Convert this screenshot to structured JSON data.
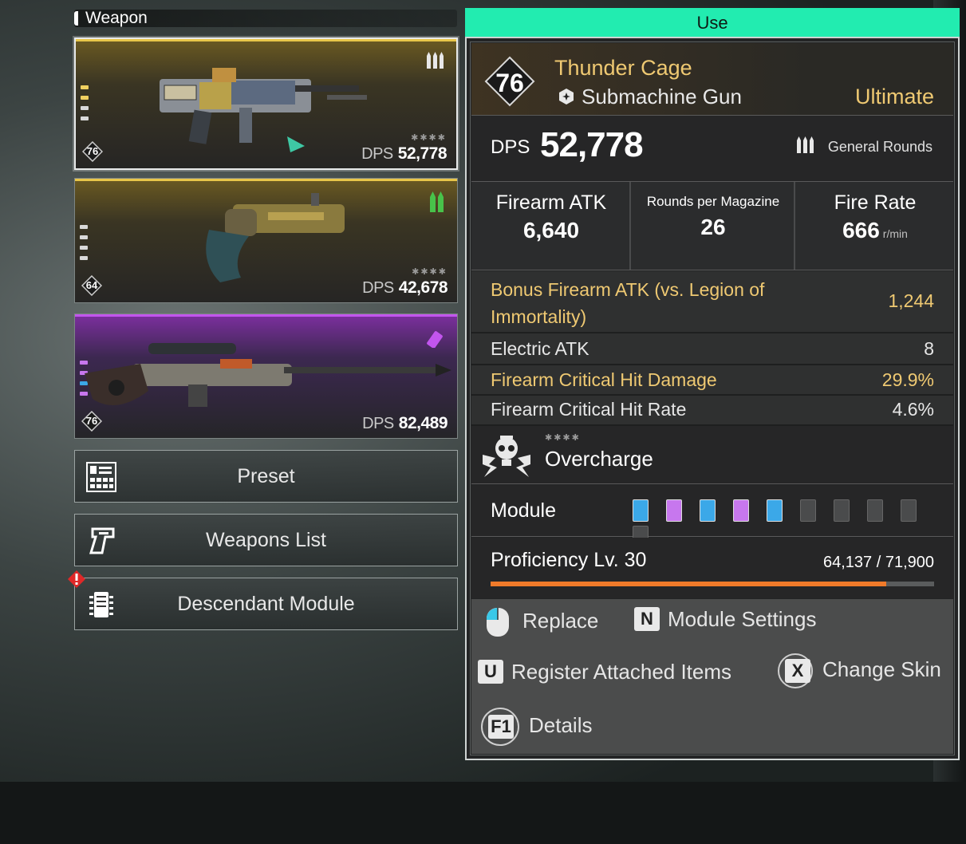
{
  "section": {
    "title": "Weapon"
  },
  "weapons": [
    {
      "level": "76",
      "dps_label": "DPS",
      "dps": "52,778",
      "stars": "✱✱✱✱",
      "ammo": "general-rounds-icon"
    },
    {
      "level": "64",
      "dps_label": "DPS",
      "dps": "42,678",
      "stars": "✱✱✱✱",
      "ammo": "special-rounds-icon"
    },
    {
      "level": "76",
      "dps_label": "DPS",
      "dps": "82,489",
      "ammo": "impact-rounds-icon"
    }
  ],
  "menu": {
    "preset": "Preset",
    "weapons_list": "Weapons List",
    "descendant_module": "Descendant Module"
  },
  "detail": {
    "use": "Use",
    "level": "76",
    "name": "Thunder Cage",
    "type": "Submachine Gun",
    "rarity": "Ultimate",
    "dps_label": "DPS",
    "dps": "52,778",
    "ammo_type": "General Rounds",
    "stats": {
      "atk_label": "Firearm ATK",
      "atk": "6,640",
      "mag_label": "Rounds per Magazine",
      "mag": "26",
      "rate_label": "Fire Rate",
      "rate": "666",
      "rate_unit": "r/min"
    },
    "substats": [
      {
        "label": "Bonus Firearm ATK (vs. Legion of",
        "label2": "Immortality)",
        "value": "1,244"
      },
      {
        "label": "Electric ATK",
        "value": "8"
      },
      {
        "label": "Firearm Critical Hit Damage",
        "value": "29.9%"
      },
      {
        "label": "Firearm Critical Hit Rate",
        "value": "4.6%"
      }
    ],
    "overcharge": {
      "stars": "✱✱✱✱",
      "name": "Overcharge"
    },
    "module": {
      "label": "Module",
      "slots": [
        "blue",
        "purple",
        "blue",
        "purple",
        "blue",
        "empty",
        "empty",
        "empty",
        "empty",
        "empty"
      ]
    },
    "proficiency": {
      "label": "Proficiency Lv. 30",
      "value": "64,137 / 71,900",
      "progress": 0.892
    },
    "actions": {
      "replace": "Replace",
      "module_settings_key": "N",
      "module_settings": "Module Settings",
      "register_key": "U",
      "register": "Register Attached Items",
      "skin_key": "X",
      "skin": "Change Skin",
      "details_key": "F1",
      "details": "Details"
    }
  },
  "colors": {
    "accent": "#22ecb0",
    "gold": "#efc972",
    "progress": "#f07a2a",
    "slot_blue": "#3ba8e8",
    "slot_purple": "#c777ee"
  }
}
